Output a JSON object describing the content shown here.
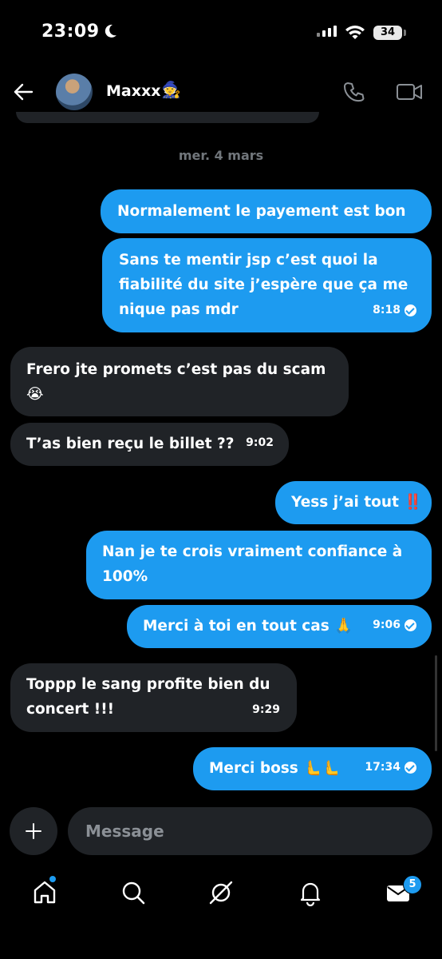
{
  "status_bar": {
    "time": "23:09",
    "battery": "34"
  },
  "header": {
    "contact_name": "Maxxx",
    "contact_emoji": "🧙"
  },
  "date_separator": "mer. 4 mars",
  "messages": [
    {
      "direction": "outgoing",
      "lines": [
        "Normalement le payement est bon"
      ]
    },
    {
      "direction": "outgoing",
      "lines": [
        "Sans te mentir jsp c’est quoi la",
        "fiabilité du site j’espère que ça me",
        "nique pas mdr"
      ],
      "time": "8:18",
      "read": true
    },
    {
      "direction": "incoming",
      "lines": [
        "Frero jte promets c’est pas du scam",
        "😭"
      ]
    },
    {
      "direction": "incoming",
      "lines": [
        "T’as bien reçu le billet ??"
      ],
      "time": "9:02"
    },
    {
      "direction": "outgoing",
      "lines": [
        "Yess j’ai tout ‼️"
      ]
    },
    {
      "direction": "outgoing",
      "lines": [
        "Nan je te crois vraiment confiance à",
        "100%"
      ]
    },
    {
      "direction": "outgoing",
      "lines": [
        "Merci à toi en tout cas 🙏"
      ],
      "time": "9:06",
      "read": true
    },
    {
      "direction": "incoming",
      "lines": [
        "Toppp le sang profite bien du",
        "concert !!!"
      ],
      "time": "9:29"
    },
    {
      "direction": "outgoing",
      "lines": [
        "Merci boss 🫷🫷"
      ],
      "time": "17:34",
      "read": true
    }
  ],
  "composer": {
    "placeholder": "Message"
  },
  "nav": {
    "messages_badge": "5"
  },
  "colors": {
    "accent": "#1d9bf0",
    "incoming_bubble": "#202327",
    "background": "#000000"
  }
}
